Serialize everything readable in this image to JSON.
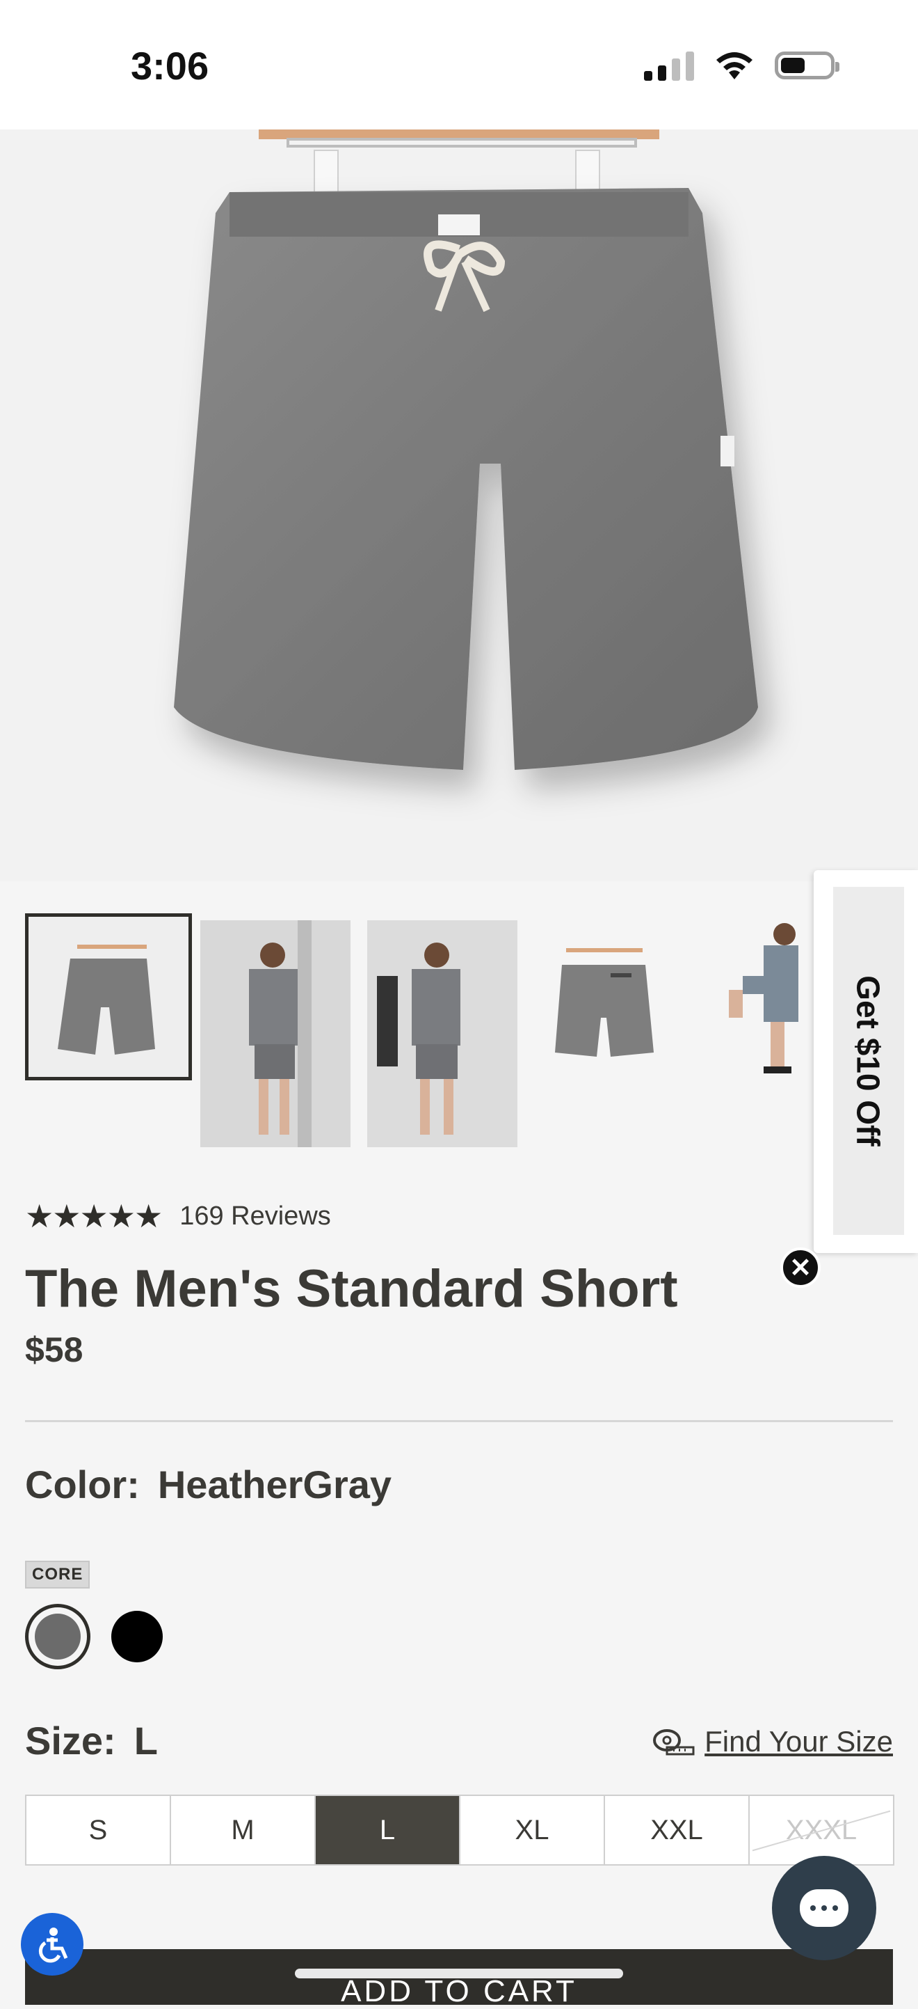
{
  "status_bar": {
    "time": "3:06"
  },
  "rating": {
    "stars": "★★★★★",
    "review_count": "169 Reviews"
  },
  "product": {
    "title": "The Men's Standard Short",
    "price": "$58"
  },
  "color": {
    "label": "Color:",
    "value": "HeatherGray",
    "badge": "CORE"
  },
  "size": {
    "label": "Size:",
    "value": "L",
    "find_size": "Find Your Size",
    "options": [
      "S",
      "M",
      "L",
      "XL",
      "XXL",
      "XXXL"
    ]
  },
  "promo": {
    "text": "Get $10 Off"
  },
  "cart": {
    "label": "ADD TO CART"
  },
  "icons": [
    "signal-icon",
    "wifi-icon",
    "battery-icon",
    "star-icon",
    "tape-measure-icon",
    "close-icon",
    "accessibility-icon",
    "chat-icon"
  ]
}
